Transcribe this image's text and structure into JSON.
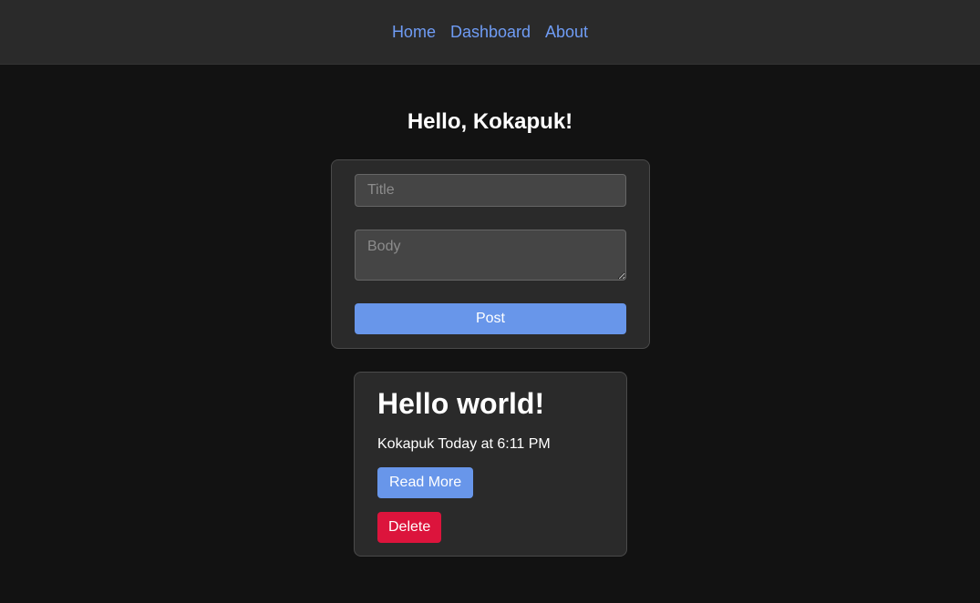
{
  "nav": {
    "items": [
      {
        "label": "Home"
      },
      {
        "label": "Dashboard"
      },
      {
        "label": "About"
      }
    ]
  },
  "greeting": "Hello, Kokapuk!",
  "form": {
    "title_placeholder": "Title",
    "title_value": "",
    "body_placeholder": "Body",
    "body_value": "",
    "post_label": "Post"
  },
  "posts": [
    {
      "title": "Hello world!",
      "meta": "Kokapuk Today at 6:11 PM",
      "read_more_label": "Read More",
      "delete_label": "Delete"
    }
  ],
  "colors": {
    "accent": "#6896ea",
    "link": "#6f9cf5",
    "danger": "#dc143c",
    "background": "#121212",
    "surface": "#2a2a2a"
  }
}
